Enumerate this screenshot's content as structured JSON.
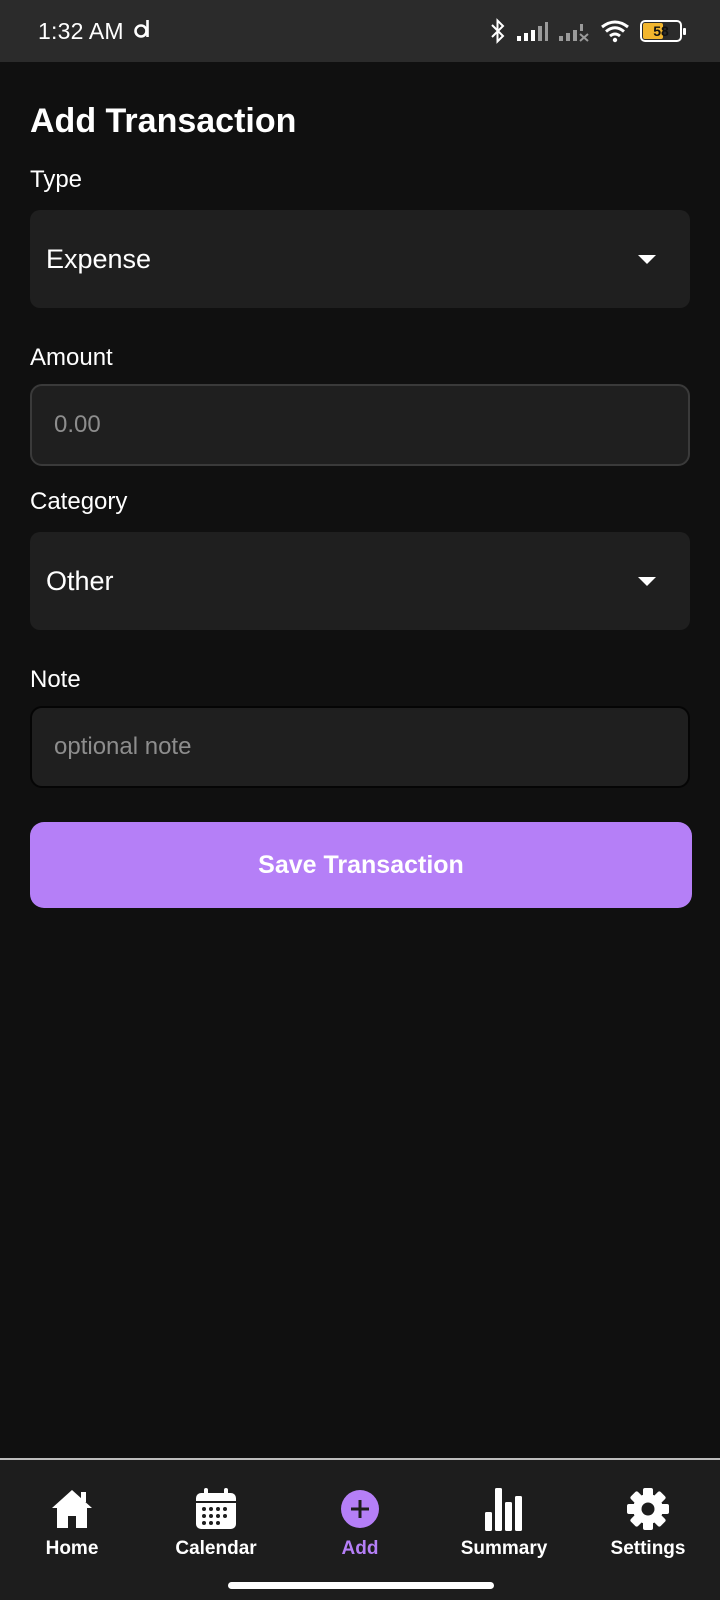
{
  "status_bar": {
    "time": "1:32 AM",
    "battery_level": "58",
    "battery_percent": 58,
    "battery_color": "#f2b62e"
  },
  "page": {
    "title": "Add Transaction"
  },
  "form": {
    "type_label": "Type",
    "type_value": "Expense",
    "amount_label": "Amount",
    "amount_placeholder": "0.00",
    "category_label": "Category",
    "category_value": "Other",
    "note_label": "Note",
    "note_placeholder": "optional note",
    "save_label": "Save Transaction"
  },
  "nav": {
    "items": [
      {
        "label": "Home",
        "icon": "home-icon"
      },
      {
        "label": "Calendar",
        "icon": "calendar-icon"
      },
      {
        "label": "Add",
        "icon": "add-icon",
        "active": true
      },
      {
        "label": "Summary",
        "icon": "bar-chart-icon"
      },
      {
        "label": "Settings",
        "icon": "gear-icon"
      }
    ]
  },
  "colors": {
    "accent": "#b57ff7",
    "background": "#101010",
    "field": "#1f1f1f"
  }
}
